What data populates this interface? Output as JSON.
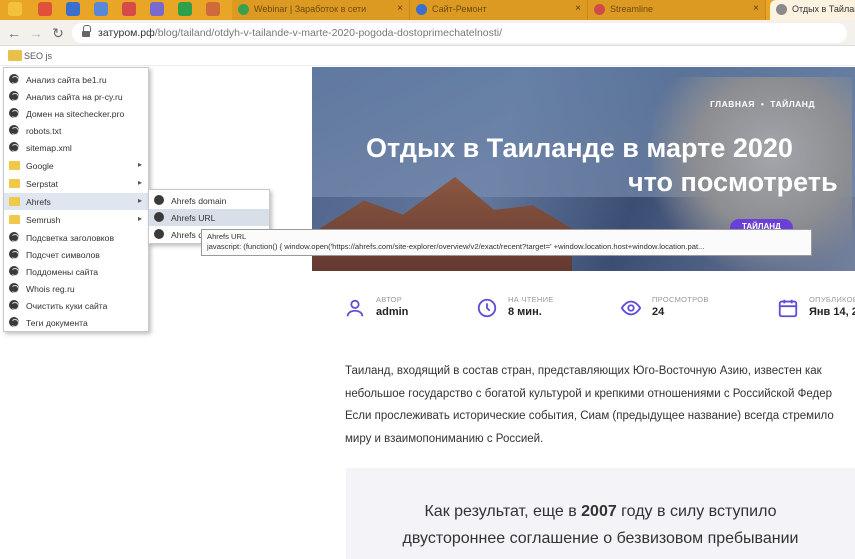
{
  "browser": {
    "tabs": [
      {
        "title": "Webinar | Заработок в сети",
        "active": false
      },
      {
        "title": "Сайт-Ремонт",
        "active": false
      },
      {
        "title": "Streamline",
        "active": false
      },
      {
        "title": "Отдых в Тайланде",
        "active": true
      }
    ],
    "url_host": "затуром.рф",
    "url_path": "/blog/tailand/otdyh-v-tailande-v-marte-2020-pogoda-dostoprimechatelnosti/",
    "bookmark_folder": "SEO js"
  },
  "context_menu": {
    "items": [
      {
        "label": "Анализ сайта be1.ru",
        "type": "link"
      },
      {
        "label": "Анализ сайта на pr-cy.ru",
        "type": "link"
      },
      {
        "label": "Домен на sitechecker.pro",
        "type": "link"
      },
      {
        "label": "robots.txt",
        "type": "link"
      },
      {
        "label": "sitemap.xml",
        "type": "link"
      },
      {
        "label": "Google",
        "type": "folder"
      },
      {
        "label": "Serpstat",
        "type": "folder"
      },
      {
        "label": "Ahrefs",
        "type": "folder"
      },
      {
        "label": "Semrush",
        "type": "folder"
      },
      {
        "label": "Подсветка заголовков",
        "type": "link"
      },
      {
        "label": "Подсчет символов",
        "type": "link"
      },
      {
        "label": "Поддомены сайта",
        "type": "link"
      },
      {
        "label": "Whois reg.ru",
        "type": "link"
      },
      {
        "label": "Очистить куки сайта",
        "type": "link"
      },
      {
        "label": "Теги документа",
        "type": "link"
      }
    ],
    "submenu": [
      {
        "label": "Ahrefs domain"
      },
      {
        "label": "Ahrefs URL"
      },
      {
        "label": "Ahrefs d"
      }
    ],
    "tooltip_title": "Ahrefs URL",
    "tooltip_code": "javascript: (function() { window.open('https://ahrefs.com/site-explorer/overview/v2/exact/recent?target=' +window.location.host+window.location.pat..."
  },
  "hero": {
    "crumb_home": "ГЛАВНАЯ",
    "crumb_dot": "•",
    "crumb_current": "ТАЙЛАНД",
    "title_line1": "Отдых в Таиланде в марте 2020",
    "title_line2": "что посмотреть",
    "category": "ТАЙЛАНД"
  },
  "meta": [
    {
      "label": "АВТОР",
      "value": "admin",
      "icon": "user-icon"
    },
    {
      "label": "НА ЧТЕНИЕ",
      "value": "8 мин.",
      "icon": "clock-icon"
    },
    {
      "label": "ПРОСМОТРОВ",
      "value": "24",
      "icon": "eye-icon"
    },
    {
      "label": "ОПУБЛИКОВАНО",
      "value": "Янв 14, 2",
      "icon": "calendar-icon"
    }
  ],
  "article": {
    "lines": [
      "Таиланд, входящий в состав стран, представляющих Юго-Восточную Азию, известен как",
      "небольшое государство с богатой культурой и крепкими отношениями с Российской Федер",
      "Если прослеживать исторические события, Сиам (предыдущее название) всегда стремило",
      "миру и взаимопониманию с Россией."
    ],
    "quote_pre": "Как результат, еще в ",
    "quote_year": "2007",
    "quote_post": " году в силу вступило",
    "quote_line2": "двустороннее соглашение о безвизовом пребывании"
  }
}
